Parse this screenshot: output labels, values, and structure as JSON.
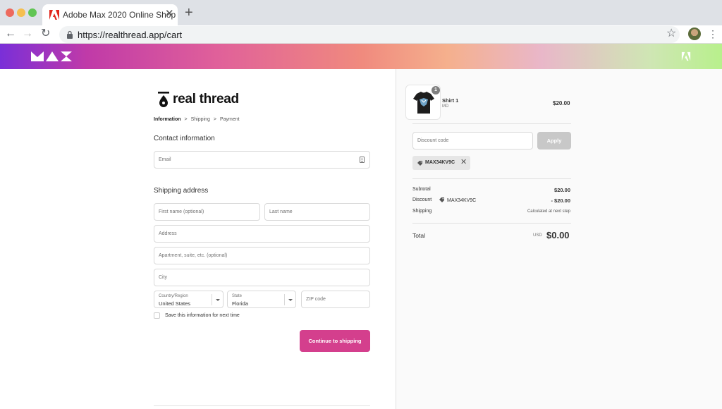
{
  "browser": {
    "tab_title": "Adobe Max 2020 Online Shop",
    "tab_close": "✕",
    "new_tab": "+",
    "url": "https://realthread.app/cart",
    "back": "←",
    "forward": "→",
    "reload": "↻",
    "star": "☆",
    "menu": "⋮"
  },
  "brand": {
    "name": "real thread"
  },
  "breadcrumbs": {
    "information": "Information",
    "shipping": "Shipping",
    "payment": "Payment",
    "separator": ">"
  },
  "contact": {
    "title": "Contact information",
    "email_placeholder": "Email"
  },
  "shipping": {
    "title": "Shipping address",
    "first_name_placeholder": "First name (optional)",
    "last_name_placeholder": "Last name",
    "address_placeholder": "Address",
    "apartment_placeholder": "Apartment, suite, etc. (optional)",
    "city_placeholder": "City",
    "country_label": "Country/Region",
    "country_value": "United States",
    "state_label": "State",
    "state_value": "Florida",
    "zip_placeholder": "ZIP code",
    "save_info_label": "Save this information for next time",
    "save_info_checked": false,
    "continue_label": "Continue to shipping"
  },
  "order": {
    "item_name": "Shirt 1",
    "item_variant": "MD",
    "item_quantity": "1",
    "item_price": "$20.00",
    "discount_placeholder": "Discount code",
    "apply_label": "Apply",
    "applied_code": "MAX34KV9C",
    "remove_code": "✕",
    "subtotal_label": "Subtotal",
    "subtotal_value": "$20.00",
    "discount_label": "Discount",
    "discount_code": "MAX34KV9C",
    "discount_value": "- $20.00",
    "shipping_label": "Shipping",
    "shipping_value": "Calculated at next step",
    "total_label": "Total",
    "total_currency": "USD",
    "total_value": "$0.00"
  },
  "colors": {
    "primary_button": "#d43f8d",
    "apply_button_disabled": "#c8c8c8"
  },
  "icons": {
    "favicon": "adobe-icon",
    "lock": "lock-icon",
    "banner_logo": "max-logo",
    "banner_right": "adobe-icon",
    "email_field": "contact-card-icon",
    "tag": "tag-icon"
  }
}
